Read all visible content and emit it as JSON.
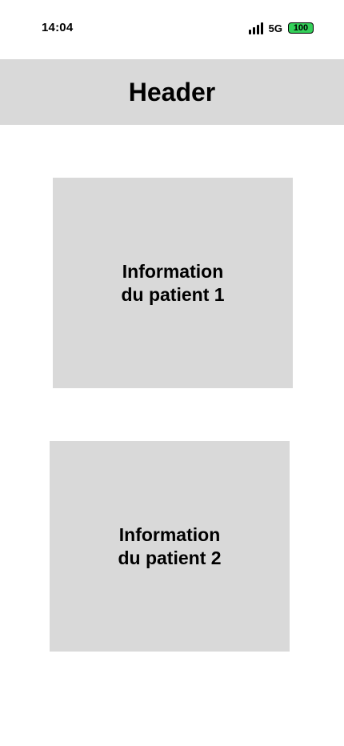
{
  "status_bar": {
    "time": "14:04",
    "network": "5G",
    "battery": "100",
    "battery_color": "#34d15a",
    "signal_icon": "signal-bars-icon"
  },
  "header": {
    "title": "Header",
    "background": "#d9d9d9"
  },
  "cards": [
    {
      "label": "Information du patient 1"
    },
    {
      "label": "Information du patient 2"
    }
  ]
}
